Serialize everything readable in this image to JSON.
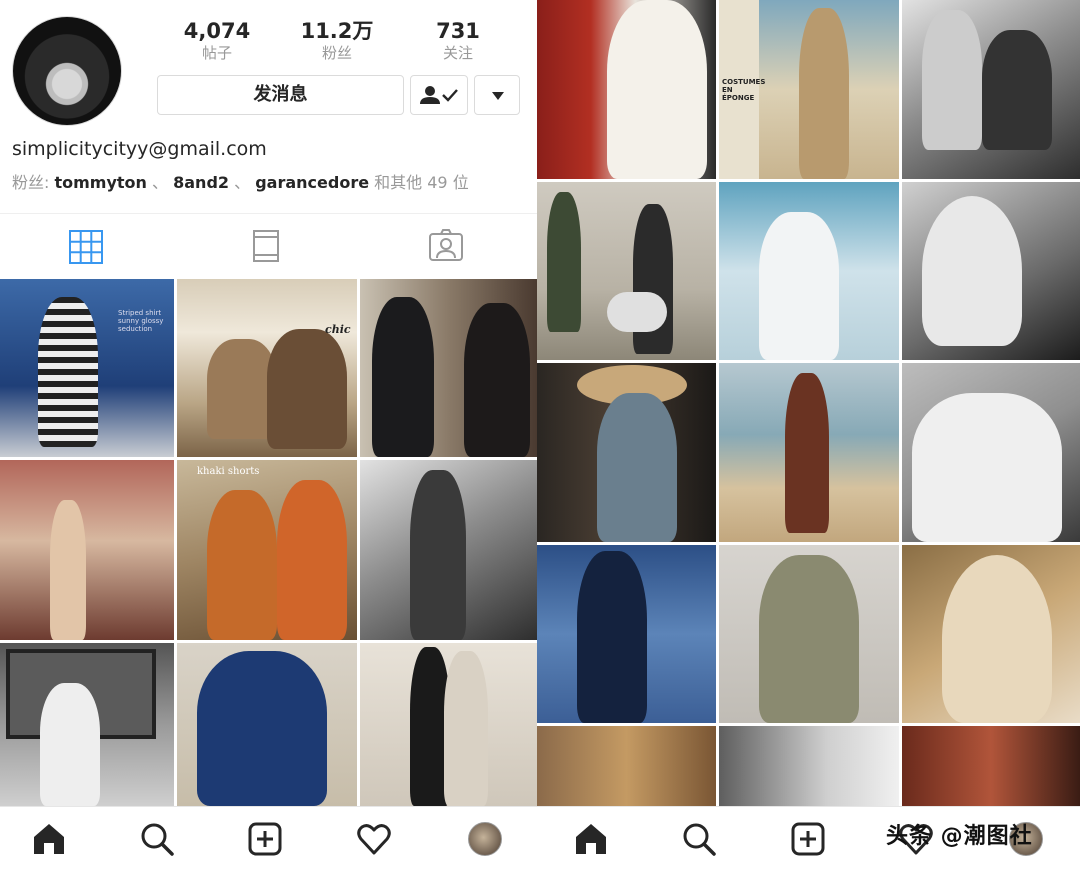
{
  "profile": {
    "email": "simplicitycityy@gmail.com",
    "stats": [
      {
        "value": "4,074",
        "label": "帖子"
      },
      {
        "value": "11.2万",
        "label": "粉丝"
      },
      {
        "value": "731",
        "label": "关注"
      }
    ],
    "message_button": "发消息",
    "followers_prefix": "粉丝: ",
    "followed_by": [
      "tommyton",
      "8and2",
      "garancedore"
    ],
    "separator": " 、 ",
    "followers_suffix": " 和其他 49 位"
  },
  "tabs": [
    "grid-icon",
    "feed-icon",
    "tagged-icon"
  ],
  "photos_left": [
    {
      "caption": "Striped shirt blue sea",
      "text": "Striped shirt\nsunny glossy\nseduction"
    },
    {
      "caption": "Couple in hats",
      "text": "chic"
    },
    {
      "caption": "Two women portrait",
      "text": ""
    },
    {
      "caption": "Woman in doorway",
      "text": ""
    },
    {
      "caption": "Couple with orange scarves",
      "text": "khaki shorts"
    },
    {
      "caption": "Woman walking by wall",
      "text": ""
    },
    {
      "caption": "Woman in gallery",
      "text": ""
    },
    {
      "caption": "Woman in blue dress seated",
      "text": ""
    },
    {
      "caption": "Two women standing",
      "text": ""
    }
  ],
  "photos_right": [
    {
      "caption": "White collar blouse"
    },
    {
      "caption": "Costumes en eponge",
      "text": "COSTUMES EN ÉPONGE"
    },
    {
      "caption": "Women at cafe"
    },
    {
      "caption": "Women with scooter"
    },
    {
      "caption": "Woman in white hat"
    },
    {
      "caption": "Blonde woman portrait"
    },
    {
      "caption": "Woman in straw hat"
    },
    {
      "caption": "Woman at beach"
    },
    {
      "caption": "Woman in white shirt"
    },
    {
      "caption": "Woman in navy jacket by sea"
    },
    {
      "caption": "Woman in blazer and scarf"
    },
    {
      "caption": "Blonde girl with clip"
    },
    {
      "caption": "Women in scarves"
    },
    {
      "caption": "Couple in white"
    },
    {
      "caption": "Red haired girl"
    }
  ],
  "nav": [
    "home-icon",
    "search-icon",
    "add-icon",
    "heart-icon",
    "profile-avatar-icon"
  ],
  "watermark": "头条 @潮图社"
}
